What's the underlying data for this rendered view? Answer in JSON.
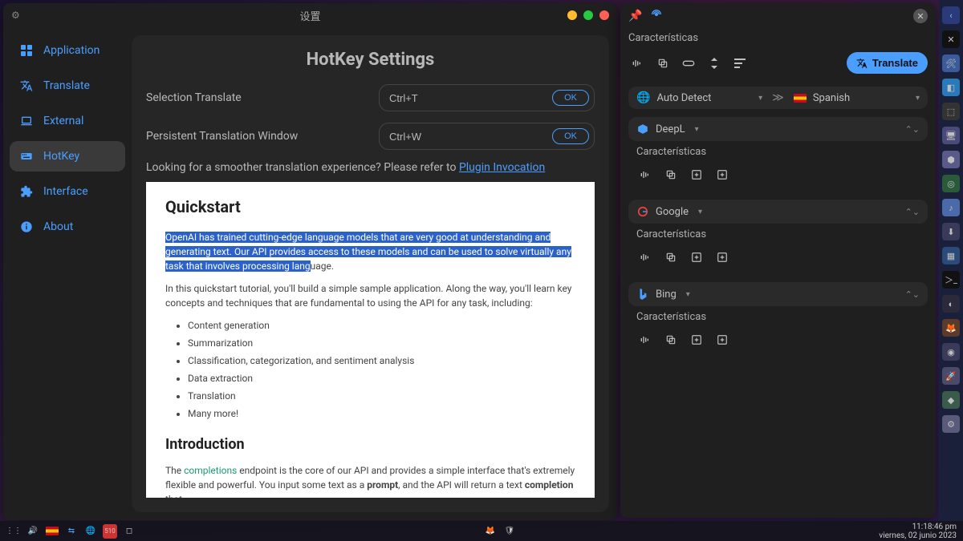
{
  "window": {
    "title": "设置"
  },
  "sidebar": {
    "items": [
      {
        "label": "Application"
      },
      {
        "label": "Translate"
      },
      {
        "label": "External"
      },
      {
        "label": "HotKey"
      },
      {
        "label": "Interface"
      },
      {
        "label": "About"
      }
    ]
  },
  "panel": {
    "title": "HotKey Settings",
    "rows": [
      {
        "label": "Selection Translate",
        "value": "Ctrl+T",
        "ok": "OK"
      },
      {
        "label": "Persistent Translation Window",
        "value": "Ctrl+W",
        "ok": "OK"
      }
    ],
    "hint_before": "Looking for a smoother translation experience? Please refer to ",
    "hint_link": "Plugin Invocation"
  },
  "doc": {
    "h1": "Quickstart",
    "p1": "OpenAI has trained cutting-edge language models that are very good at understanding and generating text. Our API provides access to these models and can be used to solve virtually any task that involves processing lang",
    "p1_tail": "uage.",
    "p2": "In this quickstart tutorial, you'll build a simple sample application. Along the way, you'll learn key concepts and techniques that are fundamental to using the API for any task, including:",
    "bullets": [
      "Content generation",
      "Summarization",
      "Classification, categorization, and sentiment analysis",
      "Data extraction",
      "Translation",
      "Many more!"
    ],
    "h2": "Introduction",
    "p3a": "The ",
    "p3link": "completions",
    "p3b": " endpoint is the core of our API and provides a simple interface that's extremely flexible and powerful. You input some text as a ",
    "p3c": "prompt",
    "p3d": ", and the API will return a text ",
    "p3e": "completion",
    "p3f": " that"
  },
  "translate_panel": {
    "features": "Características",
    "translate_btn": "Translate",
    "source": "Auto Detect",
    "target": "Spanish",
    "providers": [
      {
        "name": "DeepL"
      },
      {
        "name": "Google"
      },
      {
        "name": "Bing"
      }
    ]
  },
  "taskbar": {
    "time": "11:18:46 pm",
    "date": "viernes, 02 junio 2023",
    "net_badge": "510"
  }
}
